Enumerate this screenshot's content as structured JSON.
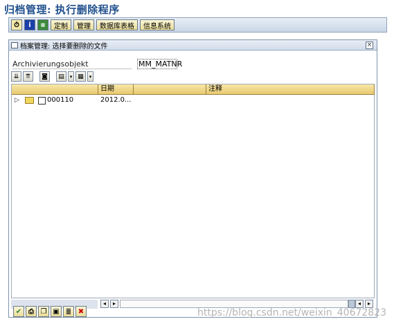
{
  "title": "归档管理: 执行删除程序",
  "app_toolbar": {
    "icons": [
      "clock-icon",
      "info-icon",
      "variant-icon"
    ],
    "buttons": [
      "定制",
      "管理",
      "数据库表格",
      "信息系统"
    ]
  },
  "dialog": {
    "title": "档案管理: 选择要删除的文件",
    "close_symbol": "×",
    "field_label": "Archivierungsobjekt",
    "field_value": "MM_MATNR",
    "columns": [
      "",
      "日期",
      "",
      "注释"
    ],
    "rows": [
      {
        "name": "000110",
        "date": "2012.0..."
      }
    ]
  },
  "bottom_toolbar": {
    "icons": [
      "check-icon",
      "print-icon",
      "copy-icon",
      "save-icon",
      "list-icon",
      "cancel-icon"
    ],
    "cancel_color": "#cc0000",
    "check_color": "#2a7d2a"
  },
  "watermark": "https://blog.csdn.net/weixin_40672823"
}
